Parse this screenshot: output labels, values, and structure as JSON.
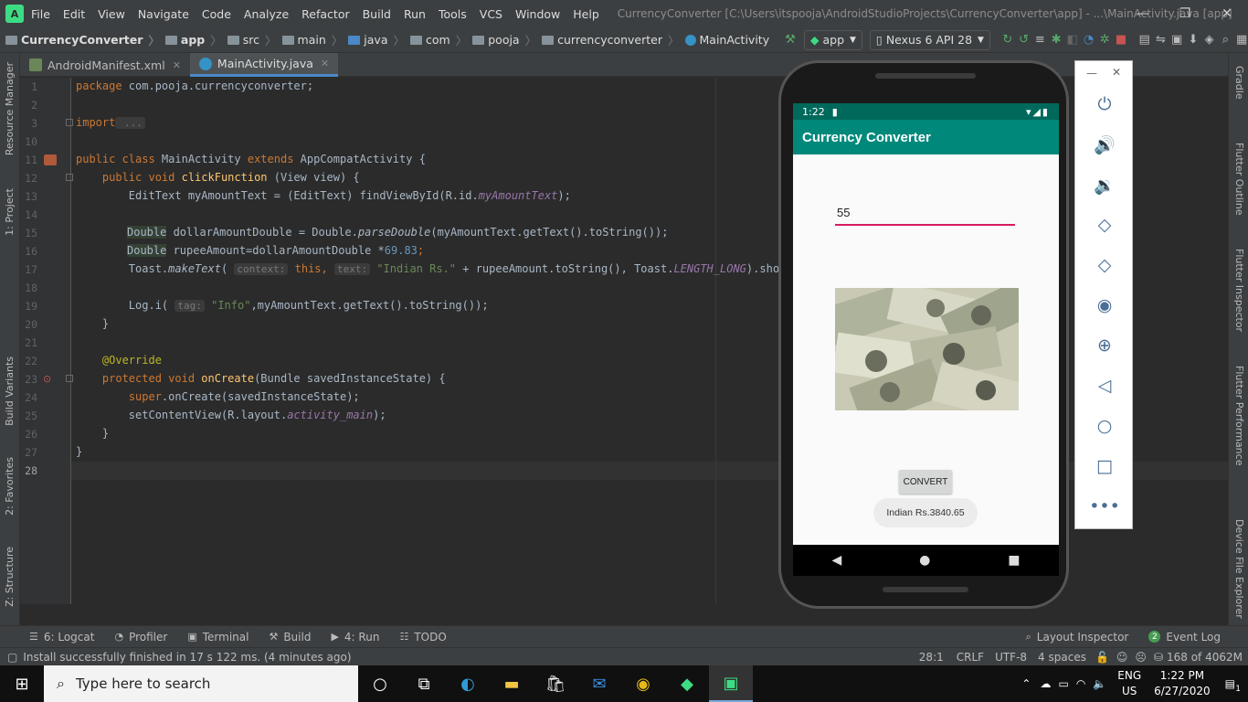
{
  "window": {
    "menus": [
      "File",
      "Edit",
      "View",
      "Navigate",
      "Code",
      "Analyze",
      "Refactor",
      "Build",
      "Run",
      "Tools",
      "VCS",
      "Window",
      "Help"
    ],
    "title": "CurrencyConverter [C:\\Users\\itspooja\\AndroidStudioProjects\\CurrencyConverter\\app] - ...\\MainActivity.java [app]"
  },
  "breadcrumbs": [
    "CurrencyConverter",
    "app",
    "src",
    "main",
    "java",
    "com",
    "pooja",
    "currencyconverter",
    "MainActivity"
  ],
  "toolbar": {
    "config": "app",
    "device": "Nexus 6 API 28"
  },
  "tabs": [
    {
      "label": "AndroidManifest.xml"
    },
    {
      "label": "MainActivity.java"
    }
  ],
  "left_tools": [
    "Resource Manager",
    "1: Project",
    "Build Variants",
    "2: Favorites",
    "Z: Structure"
  ],
  "right_tools": [
    "Gradle",
    "Flutter Outline",
    "Flutter Inspector",
    "Flutter Performance",
    "Device File Explorer"
  ],
  "editor": {
    "lines": {
      "l1a": "package",
      "l1b": " com.pooja.currencyconverter;",
      "l3a": "import",
      "l3b": " ...",
      "l11a": "public class",
      "l11b": " MainActivity ",
      "l11c": "extends",
      "l11d": " AppCompatActivity {",
      "l12a": "    public void ",
      "l12b": "clickFunction",
      "l12c": " (View view) {",
      "l13a": "        EditText myAmountText = (EditText) findViewById(R.id.",
      "l13b": "myAmountText",
      "l13c": ");",
      "l15a": "Double",
      "l15b": " dollarAmountDouble = Double.",
      "l15c": "parseDouble",
      "l15d": "(myAmountText.getText().toString());",
      "l16a": "Double",
      "l16b": " rupeeAmount=dollarAmountDouble *",
      "l16c": "69.83",
      "l16d": ";",
      "l17a": "        Toast.",
      "l17b": "makeText",
      "l17c": "( ",
      "l17h1": "context:",
      "l17d": " this",
      "l17e": ", ",
      "l17h2": "text:",
      "l17f": " \"Indian Rs.\"",
      "l17g": " + rupeeAmount.toString(), Toast.",
      "l17i": "LENGTH_LONG",
      "l17j": ").show();",
      "l19a": "        Log.i( ",
      "l19h": "tag:",
      "l19b": " \"Info\"",
      "l19c": ",myAmountText.getText().toString());",
      "l20": "    }",
      "l22": "    @Override",
      "l23a": "    protected void ",
      "l23b": "onCreate",
      "l23c": "(Bundle savedInstanceState) {",
      "l24a": "        super",
      "l24b": ".onCreate(savedInstanceState);",
      "l25a": "        setContentView(R.layout.",
      "l25b": "activity_main",
      "l25c": ");",
      "l26": "    }",
      "l27": "}"
    }
  },
  "phone": {
    "time": "1:22",
    "app_title": "Currency Converter",
    "amount_value": "55",
    "convert_label": "CONVERT",
    "toast": "Indian Rs.3840.65"
  },
  "bottom_tools": [
    "6: Logcat",
    "Profiler",
    "Terminal",
    "Build",
    "4: Run",
    "TODO",
    "Layout Inspector",
    "Event Log"
  ],
  "status": {
    "message": "Install successfully finished in 17 s 122 ms. (4 minutes ago)",
    "position": "28:1",
    "line_sep": "CRLF",
    "encoding": "UTF-8",
    "indent": "4 spaces",
    "memory": "168 of 4062M"
  },
  "taskbar": {
    "search_placeholder": "Type here to search",
    "lang1": "ENG",
    "lang2": "US",
    "time": "1:22 PM",
    "date": "6/27/2020",
    "notifications": "1",
    "event_count": "2"
  }
}
